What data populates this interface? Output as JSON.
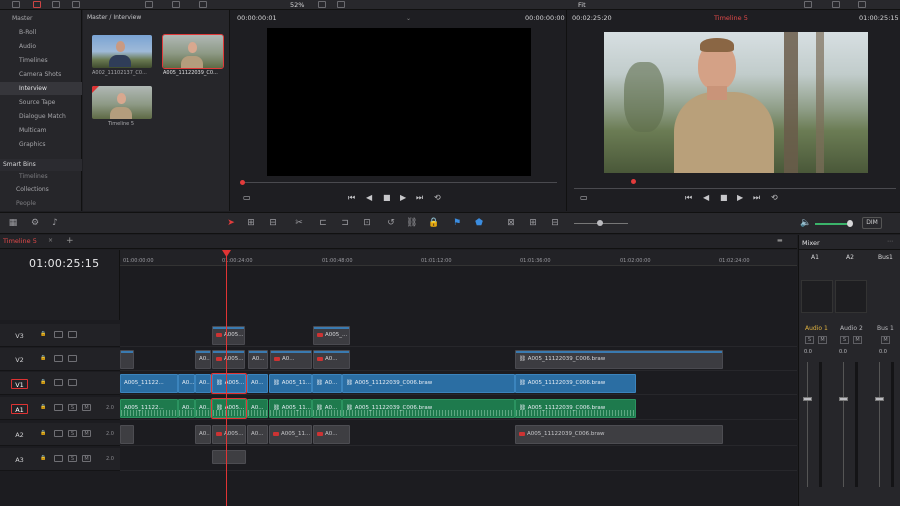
{
  "top": {
    "zoom": "52%",
    "fit": "Fit"
  },
  "bins": {
    "master": "Master",
    "items": [
      "B-Roll",
      "Audio",
      "Timelines",
      "Camera Shots",
      "Interview",
      "Source Tape",
      "Dialogue Match",
      "Multicam",
      "Graphics"
    ],
    "selected": "Interview",
    "smart_bins": "Smart Bins",
    "smart_items": [
      "Timelines",
      "Collections",
      "People"
    ]
  },
  "pool": {
    "path": "Master / Interview",
    "clips": [
      "A002_11102137_C0...",
      "A005_11122039_C0...",
      "Timeline 5"
    ]
  },
  "source_viewer": {
    "tc_left": "00:00:00:01",
    "tc_right": "00:00:00:00"
  },
  "record_viewer": {
    "duration": "00:02:25:20",
    "timeline_name": "Timeline 5",
    "tc": "01:00:25:15"
  },
  "timeline": {
    "tab": "Timeline 5",
    "timecode": "01:00:25:15",
    "ruler": [
      "01:00:00:00",
      "01:00:24:00",
      "01:00:48:00",
      "01:01:12:00",
      "01:01:36:00",
      "01:02:00:00",
      "01:02:24:00"
    ],
    "tracks": [
      {
        "name": "V3"
      },
      {
        "name": "V2"
      },
      {
        "name": "V1",
        "active": true
      },
      {
        "name": "A1",
        "active": true,
        "level": "2.0"
      },
      {
        "name": "A2",
        "level": "2.0"
      },
      {
        "name": "A3",
        "level": "2.0"
      }
    ],
    "clip_full": "A005_11122039_C006.braw",
    "clip_short": "A005_11122...",
    "clip_a0": "A0...",
    "clip_a005": "A005...",
    "clip_a005_11": "A005_11...",
    "clip_a005_": "A005_...",
    "clip_a0_": "A0..."
  },
  "mixer": {
    "title": "Mixer",
    "channels": [
      "A1",
      "A2",
      "Bus1"
    ],
    "strips": [
      "Audio 1",
      "Audio 2",
      "Bus 1"
    ],
    "level": "0.0",
    "dim": "DIM"
  }
}
